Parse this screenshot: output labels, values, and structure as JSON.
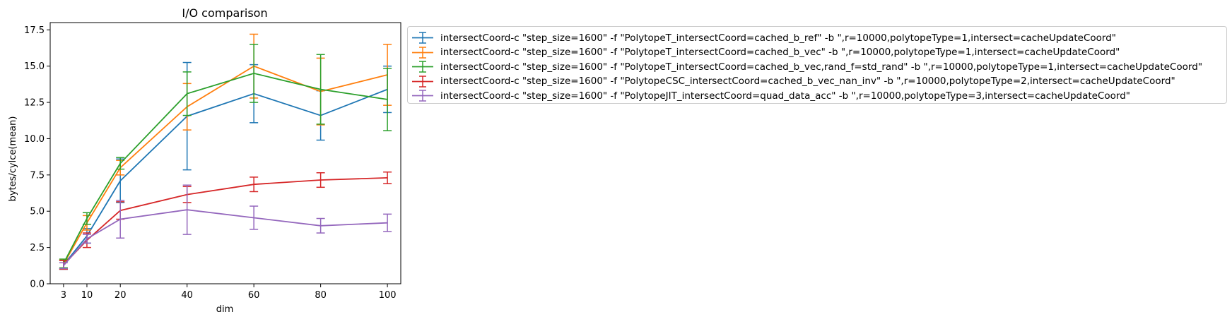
{
  "chart_data": {
    "type": "line",
    "title": "I/O comparison",
    "xlabel": "dim",
    "ylabel": "bytes/cylce(mean)",
    "x": [
      3,
      10,
      20,
      40,
      60,
      80,
      100
    ],
    "x_ticks": [
      "3",
      "10",
      "20",
      "40",
      "60",
      "80",
      "100"
    ],
    "xlim": [
      -1,
      104
    ],
    "ylim": [
      0,
      18
    ],
    "y_ticks": [
      "0.0",
      "2.5",
      "5.0",
      "7.5",
      "10.0",
      "12.5",
      "15.0",
      "17.5"
    ],
    "error_bars": true,
    "legend_position": "outside-right",
    "series": [
      {
        "name": "intersectCoord-c \"step_size=1600\" -f \"PolytopeT_intersectCoord=cached_b_ref\" -b \",r=10000,polytopeType=1,intersect=cacheUpdateCoord\"",
        "color": "#1f77b4",
        "values": [
          1.3,
          3.3,
          7.1,
          11.55,
          13.1,
          11.6,
          13.4
        ],
        "errors": [
          0.3,
          0.5,
          1.5,
          3.7,
          2.0,
          1.7,
          1.6
        ]
      },
      {
        "name": "intersectCoord-c \"step_size=1600\" -f \"PolytopeT_intersectCoord=cached_b_vec\" -b \",r=10000,polytopeType=1,intersect=cacheUpdateCoord\"",
        "color": "#ff7f0e",
        "values": [
          1.35,
          4.2,
          8.0,
          12.2,
          15.0,
          13.25,
          14.4
        ],
        "errors": [
          0.3,
          0.5,
          0.5,
          1.6,
          2.2,
          2.3,
          2.1
        ]
      },
      {
        "name": "intersectCoord-c \"step_size=1600\" -f \"PolytopeT_intersectCoord=cached_b_vec,rand_f=std_rand\" -b \",r=10000,polytopeType=1,intersect=cacheUpdateCoord\"",
        "color": "#2ca02c",
        "values": [
          1.4,
          4.5,
          8.3,
          13.1,
          14.5,
          13.4,
          12.7
        ],
        "errors": [
          0.3,
          0.4,
          0.4,
          1.5,
          2.0,
          2.4,
          2.15
        ]
      },
      {
        "name": "intersectCoord-c \"step_size=1600\" -f \"PolytopeCSC_intersectCoord=cached_b_vec_nan_inv\" -b \",r=10000,polytopeType=2,intersect=cacheUpdateCoord\"",
        "color": "#d62728",
        "values": [
          1.3,
          3.0,
          5.05,
          6.15,
          6.85,
          7.15,
          7.3
        ],
        "errors": [
          0.3,
          0.5,
          0.6,
          0.55,
          0.5,
          0.5,
          0.4
        ]
      },
      {
        "name": "intersectCoord-c \"step_size=1600\" -f \"PolytopeJIT_intersectCoord=quad_data_acc\" -b \",r=10000,polytopeType=3,intersect=cacheUpdateCoord\"",
        "color": "#9467bd",
        "values": [
          1.25,
          3.1,
          4.45,
          5.1,
          4.55,
          4.0,
          4.2
        ],
        "errors": [
          0.2,
          0.3,
          1.3,
          1.7,
          0.8,
          0.5,
          0.6
        ]
      }
    ]
  }
}
